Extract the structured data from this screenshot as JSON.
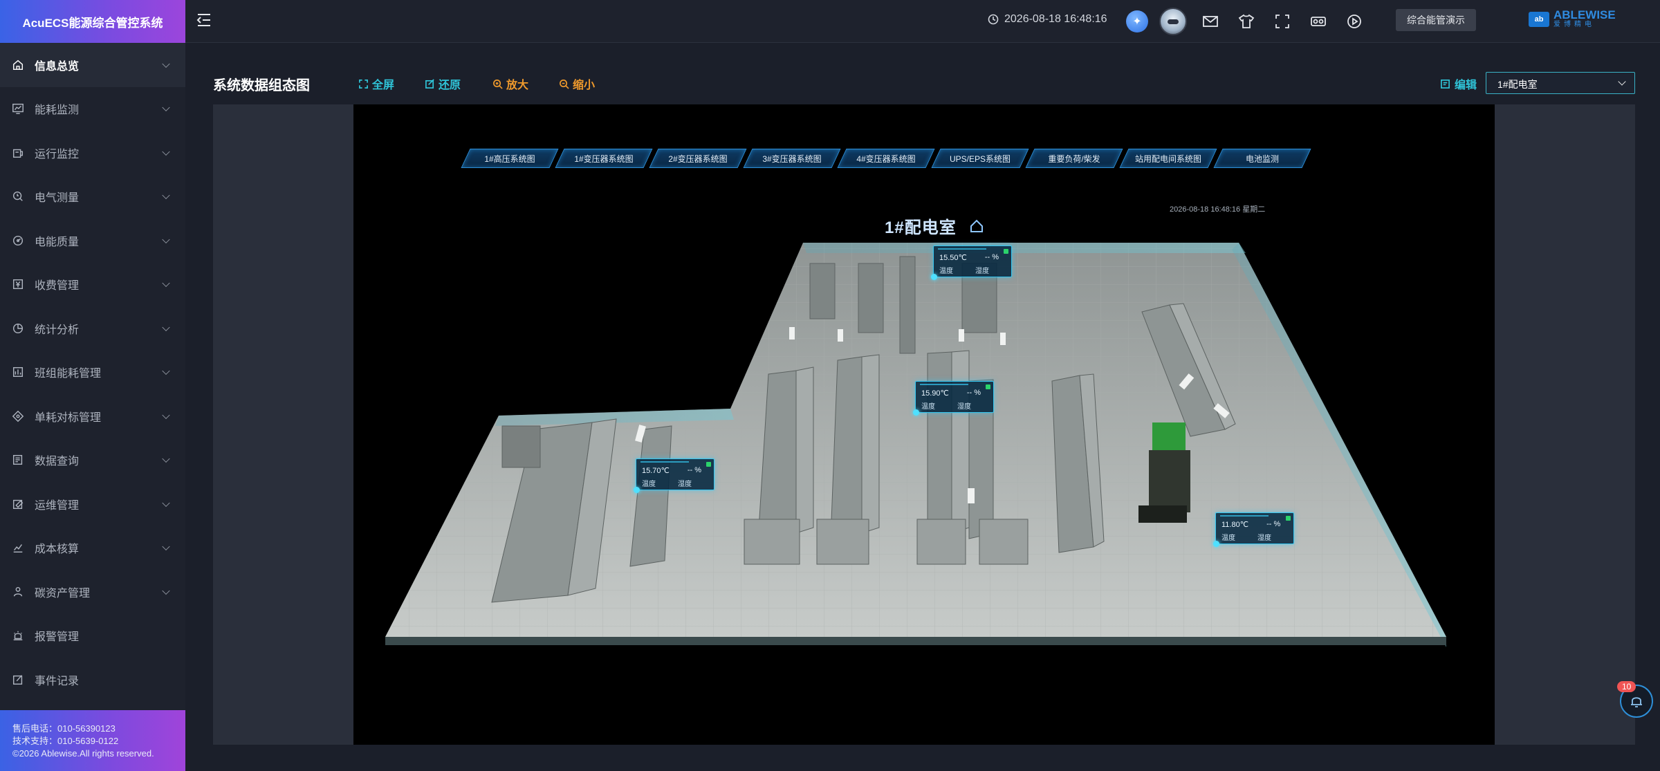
{
  "app": {
    "title": "AcuECS能源综合管控系统"
  },
  "sidebar": {
    "items": [
      {
        "label": "信息总览",
        "icon": "home-icon",
        "active": true
      },
      {
        "label": "能耗监测",
        "icon": "monitor-chart-icon"
      },
      {
        "label": "运行监控",
        "icon": "device-icon"
      },
      {
        "label": "电气测量",
        "icon": "meter-icon"
      },
      {
        "label": "电能质量",
        "icon": "gauge-icon"
      },
      {
        "label": "收费管理",
        "icon": "yen-icon"
      },
      {
        "label": "统计分析",
        "icon": "pie-icon"
      },
      {
        "label": "班组能耗管理",
        "icon": "team-icon"
      },
      {
        "label": "单耗对标管理",
        "icon": "target-icon"
      },
      {
        "label": "数据查询",
        "icon": "search-doc-icon"
      },
      {
        "label": "运维管理",
        "icon": "tools-icon"
      },
      {
        "label": "成本核算",
        "icon": "trend-icon"
      },
      {
        "label": "碳资产管理",
        "icon": "carbon-icon"
      },
      {
        "label": "报警管理",
        "icon": "alarm-icon"
      },
      {
        "label": "事件记录",
        "icon": "record-icon"
      }
    ],
    "footer": {
      "line1": "售后电话：010-56390123",
      "line2": "技术支持：010-5639-0122",
      "line3": "©2026 Ablewise.All rights reserved."
    }
  },
  "topbar": {
    "datetime": "2026-08-18 16:48:16",
    "demo_label": "综合能管演示",
    "logo": {
      "mark": "ab",
      "name": "ABLEWISE",
      "sub": "爱博精电"
    },
    "icons": [
      "ai-assistant-icon",
      "avatar",
      "mail-icon",
      "shirt-icon",
      "fullscreen-icon",
      "vr-icon",
      "play-icon"
    ]
  },
  "content": {
    "title": "系统数据组态图",
    "tools": {
      "fullscreen": "全屏",
      "restore": "还原",
      "zoom_in": "放大",
      "zoom_out": "缩小"
    },
    "edit_label": "编辑",
    "room_select": {
      "value": "1#配电室"
    }
  },
  "scene": {
    "tabs": [
      "1#高压系统图",
      "1#变压器系统图",
      "2#变压器系统图",
      "3#变压器系统图",
      "4#变压器系统图",
      "UPS/EPS系统图",
      "重要负荷/柴发",
      "站用配电间系统图",
      "电池监测"
    ],
    "title": "1#配电室",
    "datetime": "2026-08-18 16:48:16 星期二",
    "sensors": [
      {
        "temp": "15.50℃",
        "hum": "-- %",
        "temp_label": "温度",
        "hum_label": "湿度"
      },
      {
        "temp": "15.90℃",
        "hum": "-- %",
        "temp_label": "温度",
        "hum_label": "湿度"
      },
      {
        "temp": "15.70℃",
        "hum": "-- %",
        "temp_label": "温度",
        "hum_label": "湿度"
      },
      {
        "temp": "11.80℃",
        "hum": "-- %",
        "temp_label": "温度",
        "hum_label": "湿度"
      }
    ]
  },
  "notifications": {
    "count": "10"
  }
}
